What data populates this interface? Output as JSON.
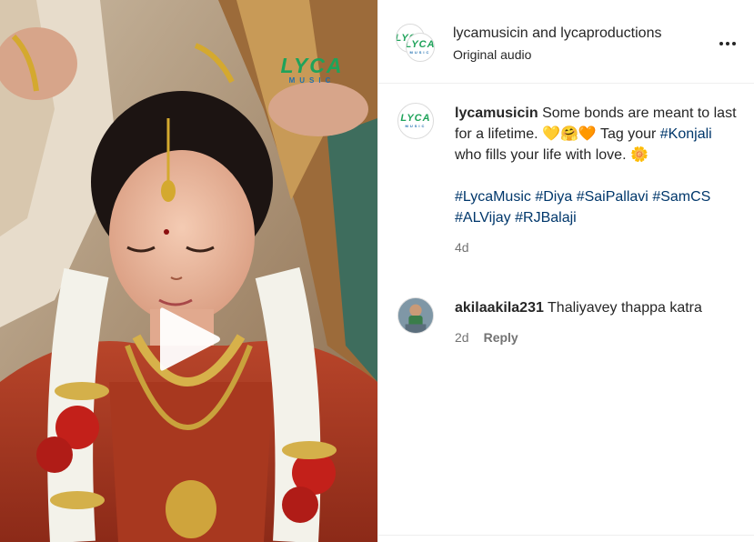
{
  "video": {
    "overlay_logo_word": "LYCA",
    "overlay_logo_sub": "MUSIC"
  },
  "header": {
    "avatar_logo_word": "LYCA",
    "avatar_logo_sub": "MUSIC",
    "user1": "lycamusicin",
    "joiner": "and",
    "user2": "lycaproductions",
    "subtitle": "Original audio"
  },
  "caption": {
    "avatar_logo_word": "LYCA",
    "avatar_logo_sub": "MUSIC",
    "username": "lycamusicin",
    "text1": "Some bonds are meant to last for a lifetime. 💛🤗🧡 Tag your",
    "hashtag_konjali": "#Konjali",
    "text2": "who fills your life with love. 🌼",
    "hashtags": [
      "#LycaMusic",
      "#Diya",
      "#SaiPallavi",
      "#SamCS",
      "#ALVijay",
      "#RJBalaji"
    ],
    "time": "4d"
  },
  "comment": {
    "username": "akilaakila231",
    "text": "Thaliyavey thappa katra",
    "time": "2d",
    "reply_label": "Reply"
  },
  "colors": {
    "hashtag": "#00376b",
    "meta": "#737373",
    "logo_green": "#1fa35a",
    "logo_blue": "#1f6fb0"
  }
}
